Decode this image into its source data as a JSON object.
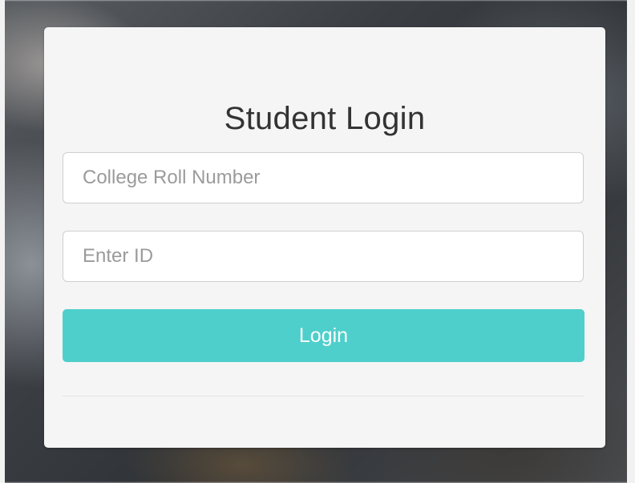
{
  "login": {
    "title": "Student Login",
    "roll_placeholder": "College Roll Number",
    "id_placeholder": "Enter ID",
    "button_label": "Login"
  },
  "colors": {
    "button": "#4ecfcb",
    "card": "#f5f5f5"
  }
}
